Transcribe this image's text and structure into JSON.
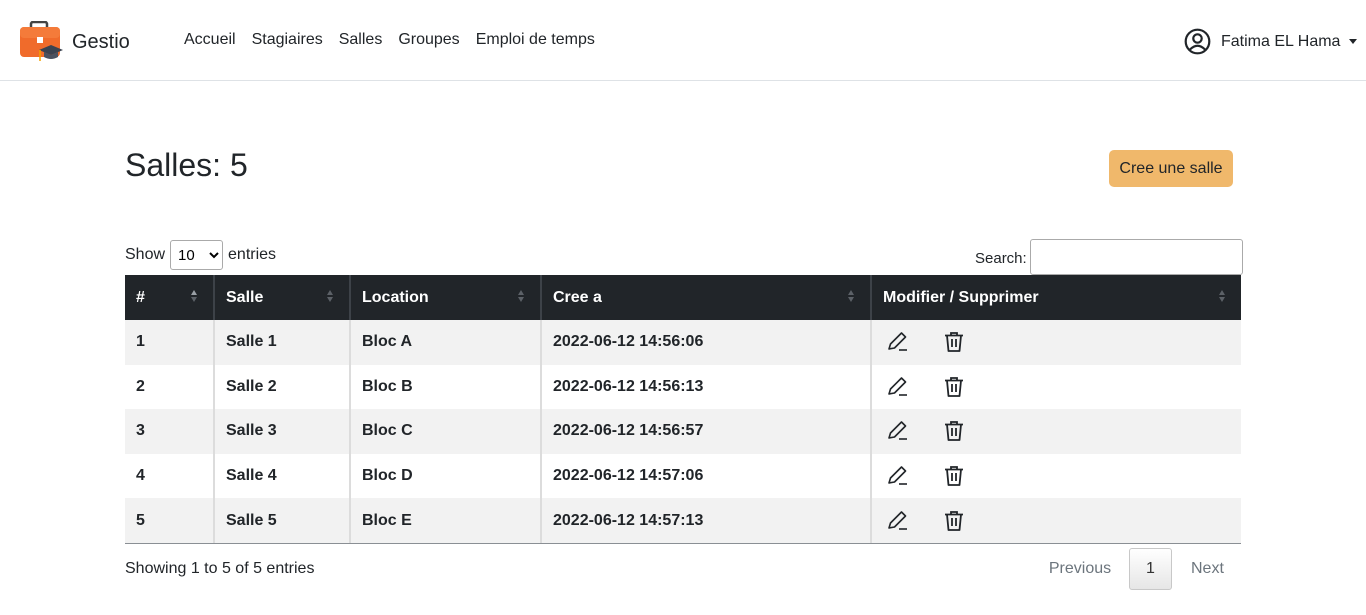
{
  "brand": {
    "name": "Gestio"
  },
  "nav": {
    "items": [
      "Accueil",
      "Stagiaires",
      "Salles",
      "Groupes",
      "Emploi de temps"
    ]
  },
  "user": {
    "name": "Fatima EL Hama"
  },
  "page": {
    "title": "Salles: 5",
    "create_label": "Cree une salle"
  },
  "length": {
    "show_label": "Show",
    "value": "10",
    "entries_label": "entries"
  },
  "search": {
    "label": "Search:",
    "value": ""
  },
  "table": {
    "headers": [
      "#",
      "Salle",
      "Location",
      "Cree a",
      "Modifier / Supprimer"
    ],
    "rows": [
      {
        "id": "1",
        "salle": "Salle 1",
        "location": "Bloc A",
        "created": "2022-06-12 14:56:06"
      },
      {
        "id": "2",
        "salle": "Salle 2",
        "location": "Bloc B",
        "created": "2022-06-12 14:56:13"
      },
      {
        "id": "3",
        "salle": "Salle 3",
        "location": "Bloc C",
        "created": "2022-06-12 14:56:57"
      },
      {
        "id": "4",
        "salle": "Salle 4",
        "location": "Bloc D",
        "created": "2022-06-12 14:57:06"
      },
      {
        "id": "5",
        "salle": "Salle 5",
        "location": "Bloc E",
        "created": "2022-06-12 14:57:13"
      }
    ]
  },
  "footer": {
    "info": "Showing 1 to 5 of 5 entries",
    "previous": "Previous",
    "page": "1",
    "next": "Next"
  },
  "colors": {
    "accent": "#f0b86b",
    "header_bg": "#212529",
    "stripe": "#f2f2f2"
  },
  "icons": {
    "logo": "briefcase-graduation-icon",
    "user": "user-circle-icon",
    "edit": "pencil-icon",
    "delete": "trash-icon"
  }
}
